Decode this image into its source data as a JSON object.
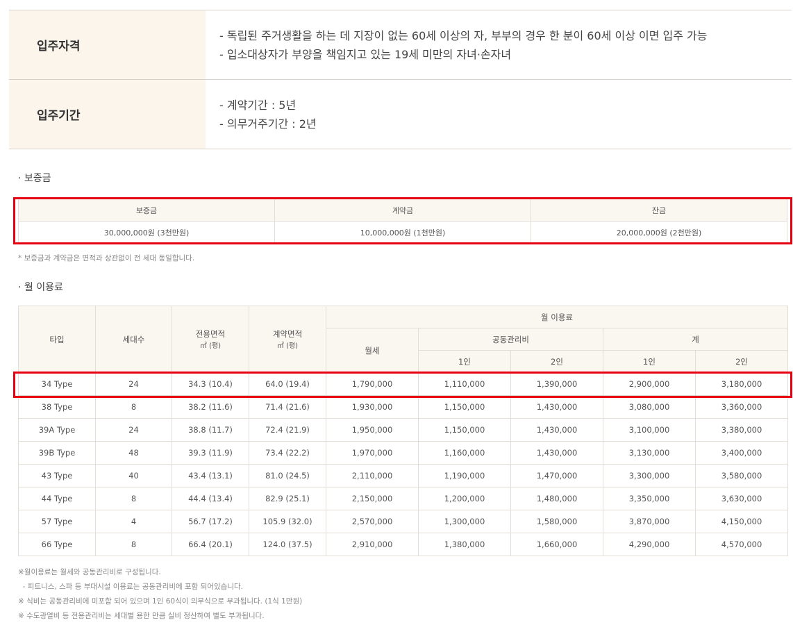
{
  "info": [
    {
      "label": "입주자격",
      "lines": [
        "- 독립된 주거생활을 하는 데 지장이 없는 60세 이상의 자, 부부의 경우 한 분이 60세 이상 이면 입주 가능",
        "- 입소대상자가 부양을 책임지고 있는 19세 미만의 자녀·손자녀"
      ]
    },
    {
      "label": "입주기간",
      "lines": [
        "- 계약기간 : 5년",
        "- 의무거주기간 : 2년"
      ]
    }
  ],
  "deposit": {
    "title": "· 보증금",
    "headers": [
      "보증금",
      "계약금",
      "잔금"
    ],
    "values": [
      "30,000,000원 (3천만원)",
      "10,000,000원 (1천만원)",
      "20,000,000원 (2천만원)"
    ],
    "note": "* 보증금과 계약금은 면적과 상관없이 전 세대 동일합니다."
  },
  "fees": {
    "title": "· 월 이용료",
    "headers": {
      "type": "타입",
      "households": "세대수",
      "exclusive_area": "전용면적",
      "contract_area": "계약면적",
      "area_unit": "㎡ (평)",
      "monthly_fee": "월 이용료",
      "rent": "월세",
      "mgmt": "공동관리비",
      "total": "계",
      "p1": "1인",
      "p2": "2인"
    },
    "rows": [
      [
        "34 Type",
        "24",
        "34.3 (10.4)",
        "64.0 (19.4)",
        "1,790,000",
        "1,110,000",
        "1,390,000",
        "2,900,000",
        "3,180,000"
      ],
      [
        "38 Type",
        "8",
        "38.2 (11.6)",
        "71.4 (21.6)",
        "1,930,000",
        "1,150,000",
        "1,430,000",
        "3,080,000",
        "3,360,000"
      ],
      [
        "39A Type",
        "24",
        "38.8 (11.7)",
        "72.4 (21.9)",
        "1,950,000",
        "1,150,000",
        "1,430,000",
        "3,100,000",
        "3,380,000"
      ],
      [
        "39B Type",
        "48",
        "39.3 (11.9)",
        "73.4 (22.2)",
        "1,970,000",
        "1,160,000",
        "1,430,000",
        "3,130,000",
        "3,400,000"
      ],
      [
        "43 Type",
        "40",
        "43.4 (13.1)",
        "81.0 (24.5)",
        "2,110,000",
        "1,190,000",
        "1,470,000",
        "3,300,000",
        "3,580,000"
      ],
      [
        "44 Type",
        "8",
        "44.4 (13.4)",
        "82.9 (25.1)",
        "2,150,000",
        "1,200,000",
        "1,480,000",
        "3,350,000",
        "3,630,000"
      ],
      [
        "57 Type",
        "4",
        "56.7 (17.2)",
        "105.9 (32.0)",
        "2,570,000",
        "1,300,000",
        "1,580,000",
        "3,870,000",
        "4,150,000"
      ],
      [
        "66 Type",
        "8",
        "66.4 (20.1)",
        "124.0 (37.5)",
        "2,910,000",
        "1,380,000",
        "1,660,000",
        "4,290,000",
        "4,570,000"
      ]
    ]
  },
  "footnotes": [
    "※월이용료는 월세와 공동관리비로 구성됩니다.",
    "  - 피트니스, 스파 등 부대시설 이용료는 공동관리비에 포함 되어있습니다.",
    "※ 식비는 공동관리비에 미포함 되어 있으며 1인 60식이 의무식으로 부과됩니다. (1식 1만원)",
    "※ 수도광열비 등 전용관리비는 세대별 용한 만큼 실비 정산하여 별도 부과됩니다."
  ],
  "colors": {
    "highlight": "#e60012",
    "label_bg": "#fbf5ec",
    "header_bg": "#faf6f0"
  }
}
